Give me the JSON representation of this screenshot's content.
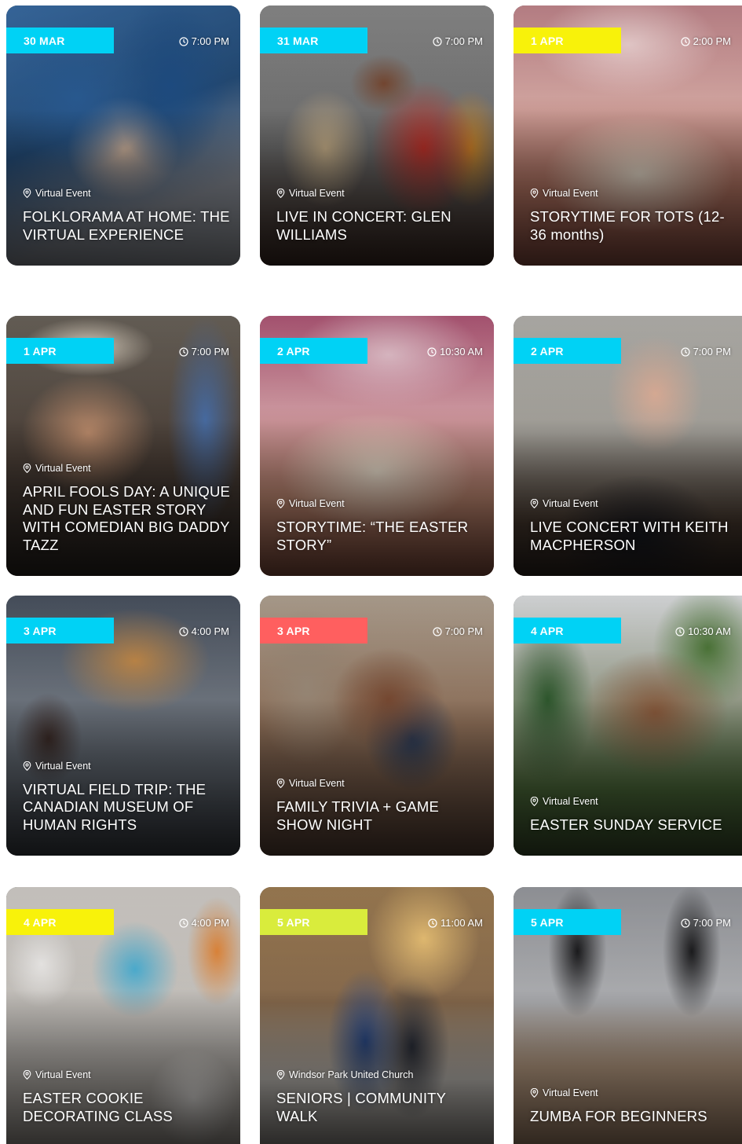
{
  "colors": {
    "cyan": "#00d2f5",
    "yellow": "#f8f20a",
    "coral": "#ff5f5f",
    "lime": "#d9ec3c"
  },
  "events": [
    {
      "date": "30 MAR",
      "badge_color": "#00d2f5",
      "time": "7:00 PM",
      "location": "Virtual Event",
      "title": "FOLKLORAMA AT HOME: THE VIRTUAL EXPERIENCE"
    },
    {
      "date": "31 MAR",
      "badge_color": "#00d2f5",
      "time": "7:00 PM",
      "location": "Virtual Event",
      "title": "LIVE IN CONCERT: GLEN WILLIAMS"
    },
    {
      "date": "1 APR",
      "badge_color": "#f8f20a",
      "time": "2:00 PM",
      "location": "Virtual Event",
      "title": "STORYTIME FOR TOTS (12-36 months)"
    },
    {
      "date": "1 APR",
      "badge_color": "#00d2f5",
      "time": "7:00 PM",
      "location": "Virtual Event",
      "title": "APRIL FOOLS DAY: A UNIQUE AND FUN EASTER STORY WITH COMEDIAN BIG DADDY TAZZ"
    },
    {
      "date": "2 APR",
      "badge_color": "#00d2f5",
      "time": "10:30 AM",
      "location": "Virtual Event",
      "title": "STORYTIME: “THE EASTER STORY”"
    },
    {
      "date": "2 APR",
      "badge_color": "#00d2f5",
      "time": "7:00 PM",
      "location": "Virtual Event",
      "title": "LIVE CONCERT WITH KEITH MACPHERSON"
    },
    {
      "date": "3 APR",
      "badge_color": "#00d2f5",
      "time": "4:00 PM",
      "location": "Virtual Event",
      "title": "VIRTUAL FIELD TRIP: THE CANADIAN MUSEUM OF HUMAN RIGHTS"
    },
    {
      "date": "3 APR",
      "badge_color": "#ff5f5f",
      "time": "7:00 PM",
      "location": "Virtual Event",
      "title": "FAMILY TRIVIA + GAME SHOW NIGHT"
    },
    {
      "date": "4 APR",
      "badge_color": "#00d2f5",
      "time": "10:30 AM",
      "location": "Virtual Event",
      "title": "EASTER SUNDAY SERVICE"
    },
    {
      "date": "4 APR",
      "badge_color": "#f8f20a",
      "time": "4:00 PM",
      "location": "Virtual Event",
      "title": "EASTER COOKIE DECORATING CLASS"
    },
    {
      "date": "5 APR",
      "badge_color": "#d9ec3c",
      "time": "11:00 AM",
      "location": "Windsor Park United Church",
      "title": "SENIORS | COMMUNITY WALK"
    },
    {
      "date": "5 APR",
      "badge_color": "#00d2f5",
      "time": "7:00 PM",
      "location": "Virtual Event",
      "title": "ZUMBA FOR BEGINNERS"
    }
  ]
}
